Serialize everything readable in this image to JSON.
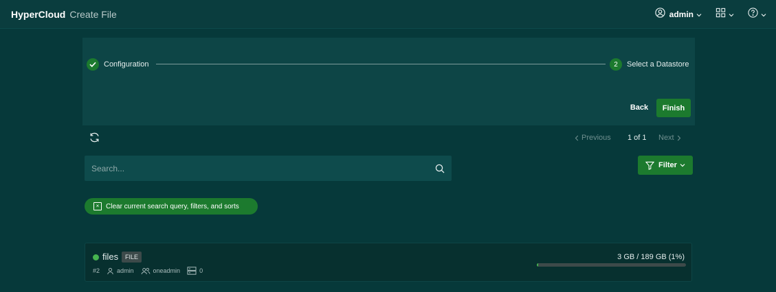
{
  "header": {
    "brand": "HyperCloud",
    "page_title": "Create File",
    "user_label": "admin",
    "icons": [
      "user-circle-icon",
      "apps-grid-icon",
      "help-circle-icon"
    ]
  },
  "stepper": {
    "steps": [
      {
        "label": "Configuration",
        "state": "completed"
      },
      {
        "label": "Select a Datastore",
        "number": "2",
        "state": "active"
      }
    ],
    "back_label": "Back",
    "finish_label": "Finish"
  },
  "pagination": {
    "prev_label": "Previous",
    "info": "1 of 1",
    "next_label": "Next"
  },
  "search": {
    "placeholder": "Search...",
    "value": ""
  },
  "filter": {
    "label": "Filter"
  },
  "clear_chip": {
    "label": "Clear current search query, filters, and sorts"
  },
  "datastores": [
    {
      "name": "files",
      "type_badge": "FILE",
      "id": "#2",
      "owner": "admin",
      "group": "oneadmin",
      "hosts_count": "0",
      "capacity_text": "3 GB / 189 GB (1%)",
      "usage_percent": 1,
      "status_color": "#46b34f"
    }
  ],
  "colors": {
    "accent": "#1c7a2e",
    "background": "#06393a",
    "status_ok": "#46b34f"
  }
}
